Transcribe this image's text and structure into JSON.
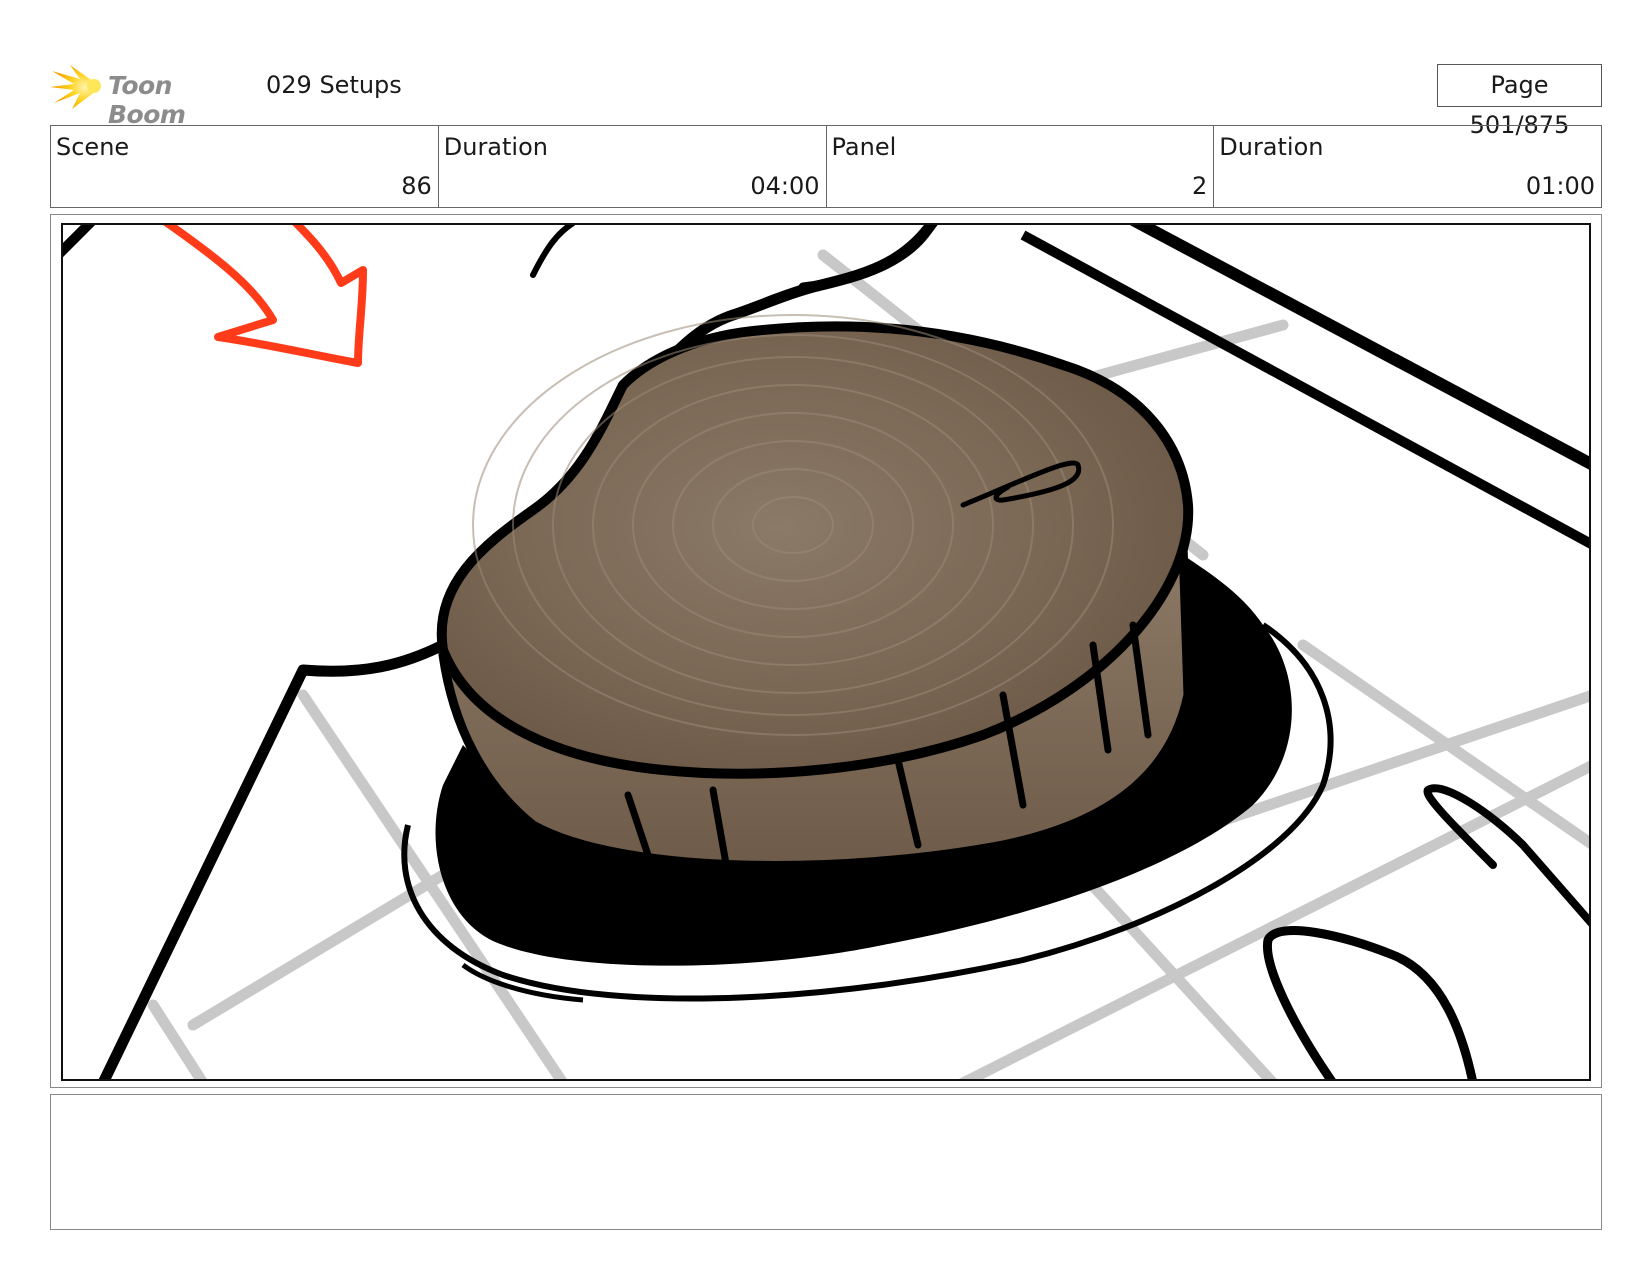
{
  "header": {
    "logo_text": "Toon Boom",
    "project_title": "029 Setups",
    "page_label": "Page 501/875"
  },
  "info": {
    "scene_label": "Scene",
    "scene_value": "86",
    "scene_duration_label": "Duration",
    "scene_duration_value": "04:00",
    "panel_label": "Panel",
    "panel_value": "2",
    "panel_duration_label": "Duration",
    "panel_duration_value": "01:00"
  },
  "panel": {
    "description": "",
    "colors": {
      "wood": "#7d6a58",
      "wood_light": "#a08e7a",
      "outline": "#000000",
      "floor_grid": "#c8c8c8",
      "arrow": "#ff3b1a"
    }
  },
  "notes": {
    "text": ""
  }
}
